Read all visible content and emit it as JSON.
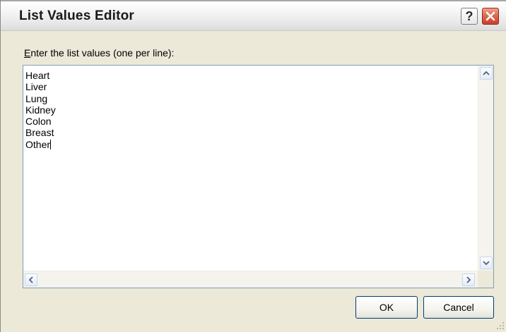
{
  "window": {
    "title": "List Values Editor"
  },
  "titlebar_buttons": {
    "help_label": "?",
    "close_icon": "close-icon"
  },
  "prompt": {
    "accelerator": "E",
    "rest": "nter the list values (one per line):"
  },
  "list": {
    "values": [
      "Heart",
      "Liver",
      "Lung",
      "Kidney",
      "Colon",
      "Breast",
      "Other"
    ]
  },
  "buttons": {
    "ok_label": "OK",
    "cancel_label": "Cancel"
  },
  "colors": {
    "dialog_bg": "#ece9d8",
    "close_button_red": "#c9402a",
    "listbox_border": "#7f9db9"
  }
}
